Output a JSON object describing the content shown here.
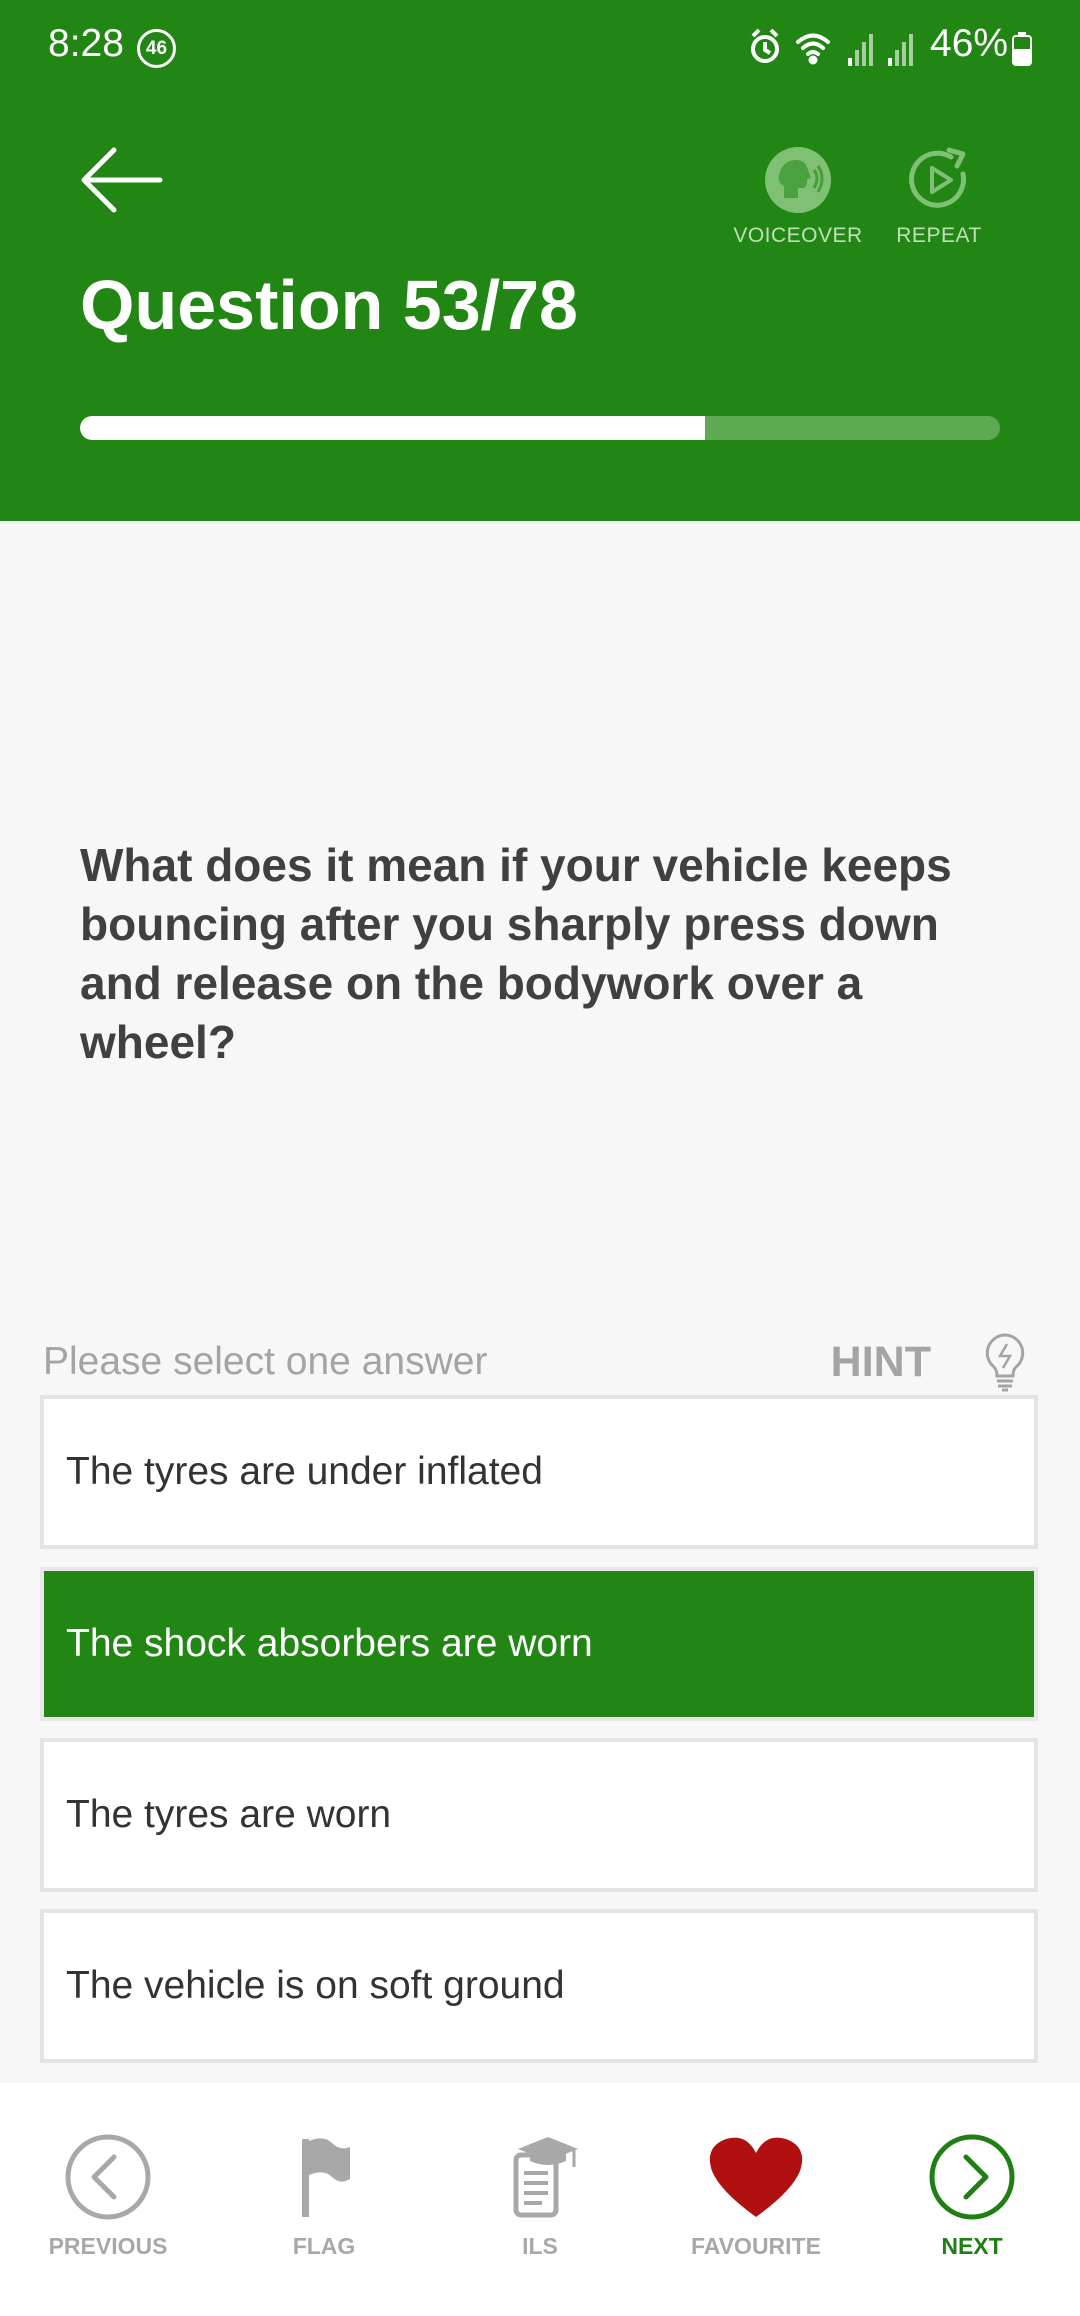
{
  "status_bar": {
    "time": "8:28",
    "badge": "46",
    "battery": "46%"
  },
  "header": {
    "title": "Question 53/78",
    "voiceover_label": "VOICEOVER",
    "repeat_label": "REPEAT",
    "progress_fraction": 0.6795,
    "colors": {
      "header_bg": "#218614",
      "progress_fill": "#ffffff",
      "progress_track": "#5daa52"
    }
  },
  "question": {
    "text": "What does it mean if your vehicle keeps bouncing after you sharply press down and release on the bodywork over a wheel?"
  },
  "answers_section": {
    "prompt": "Please select one answer",
    "hint_label": "HINT",
    "options": [
      {
        "label": "The tyres are under inflated",
        "selected": false
      },
      {
        "label": "The shock absorbers are worn",
        "selected": true
      },
      {
        "label": "The tyres are worn",
        "selected": false
      },
      {
        "label": "The vehicle is on soft ground",
        "selected": false
      }
    ]
  },
  "bottom_nav": {
    "previous": "PREVIOUS",
    "flag": "FLAG",
    "ils": "ILS",
    "favourite": "FAVOURITE",
    "next": "NEXT"
  },
  "icons": {
    "back": "arrow-left-icon",
    "voiceover": "voiceover-head-icon",
    "repeat": "replay-icon",
    "hint": "lightbulb-icon",
    "previous": "chevron-left-circle-icon",
    "flag": "flag-icon",
    "ils": "document-graduation-cap-icon",
    "favourite": "heart-icon",
    "next": "chevron-right-circle-icon"
  }
}
